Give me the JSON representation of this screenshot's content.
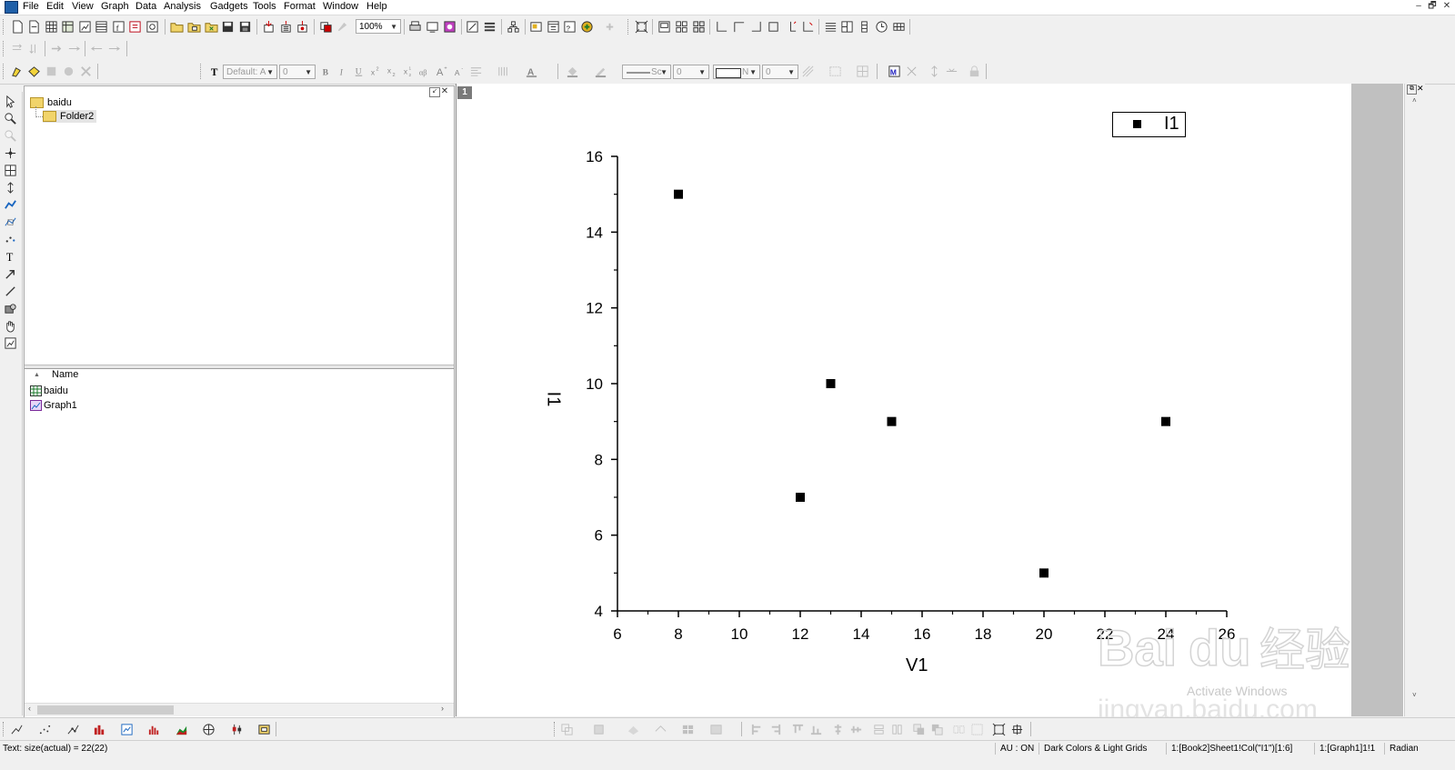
{
  "menu": [
    "File",
    "Edit",
    "View",
    "Graph",
    "Data",
    "Analysis",
    "Gadgets",
    "Tools",
    "Format",
    "Window",
    "Help"
  ],
  "window_controls": {
    "minimize": "–",
    "restore": "🗗",
    "close": "✕"
  },
  "toolbar": {
    "zoom_value": "100%",
    "font_name": "Default: A",
    "font_size": "0",
    "line_style": "Sc",
    "line_width": "0",
    "fill_label": "N",
    "fill_value": "0"
  },
  "explorer": {
    "tree": [
      {
        "label": "baidu"
      },
      {
        "label": "Folder2"
      }
    ],
    "list_header": "Name",
    "items": [
      {
        "label": "baidu",
        "type": "workbook"
      },
      {
        "label": "Graph1",
        "type": "graph"
      }
    ]
  },
  "graph": {
    "layer_tab": "1",
    "legend_label": "I1"
  },
  "chart_data": {
    "type": "scatter",
    "title": "",
    "xlabel": "V1",
    "ylabel": "I1",
    "xlim": [
      6,
      26
    ],
    "ylim": [
      4,
      16
    ],
    "xticks": [
      6,
      8,
      10,
      12,
      14,
      16,
      18,
      20,
      22,
      24,
      26
    ],
    "yticks": [
      4,
      6,
      8,
      10,
      12,
      14,
      16
    ],
    "grid": false,
    "legend_position": "top-right",
    "marker": "square",
    "series": [
      {
        "name": "I1",
        "color": "#000000",
        "x": [
          8,
          12,
          13,
          15,
          20,
          24
        ],
        "y": [
          15,
          7,
          10,
          9,
          5,
          9
        ]
      }
    ]
  },
  "watermark": {
    "brand": "Bai",
    "paw": "du",
    "cn": "经验",
    "url": "jingyan.baidu.com",
    "activate_windows": "Activate Windows"
  },
  "status": {
    "left": "Text: size(actual) = 22(22)",
    "au": "AU : ON",
    "theme": "Dark Colors & Light Grids",
    "cell": "1:[Book2]Sheet1!Col(\"I1\")[1:6]",
    "graph_ref": "1:[Graph1]1!1",
    "angle": "Radian"
  }
}
